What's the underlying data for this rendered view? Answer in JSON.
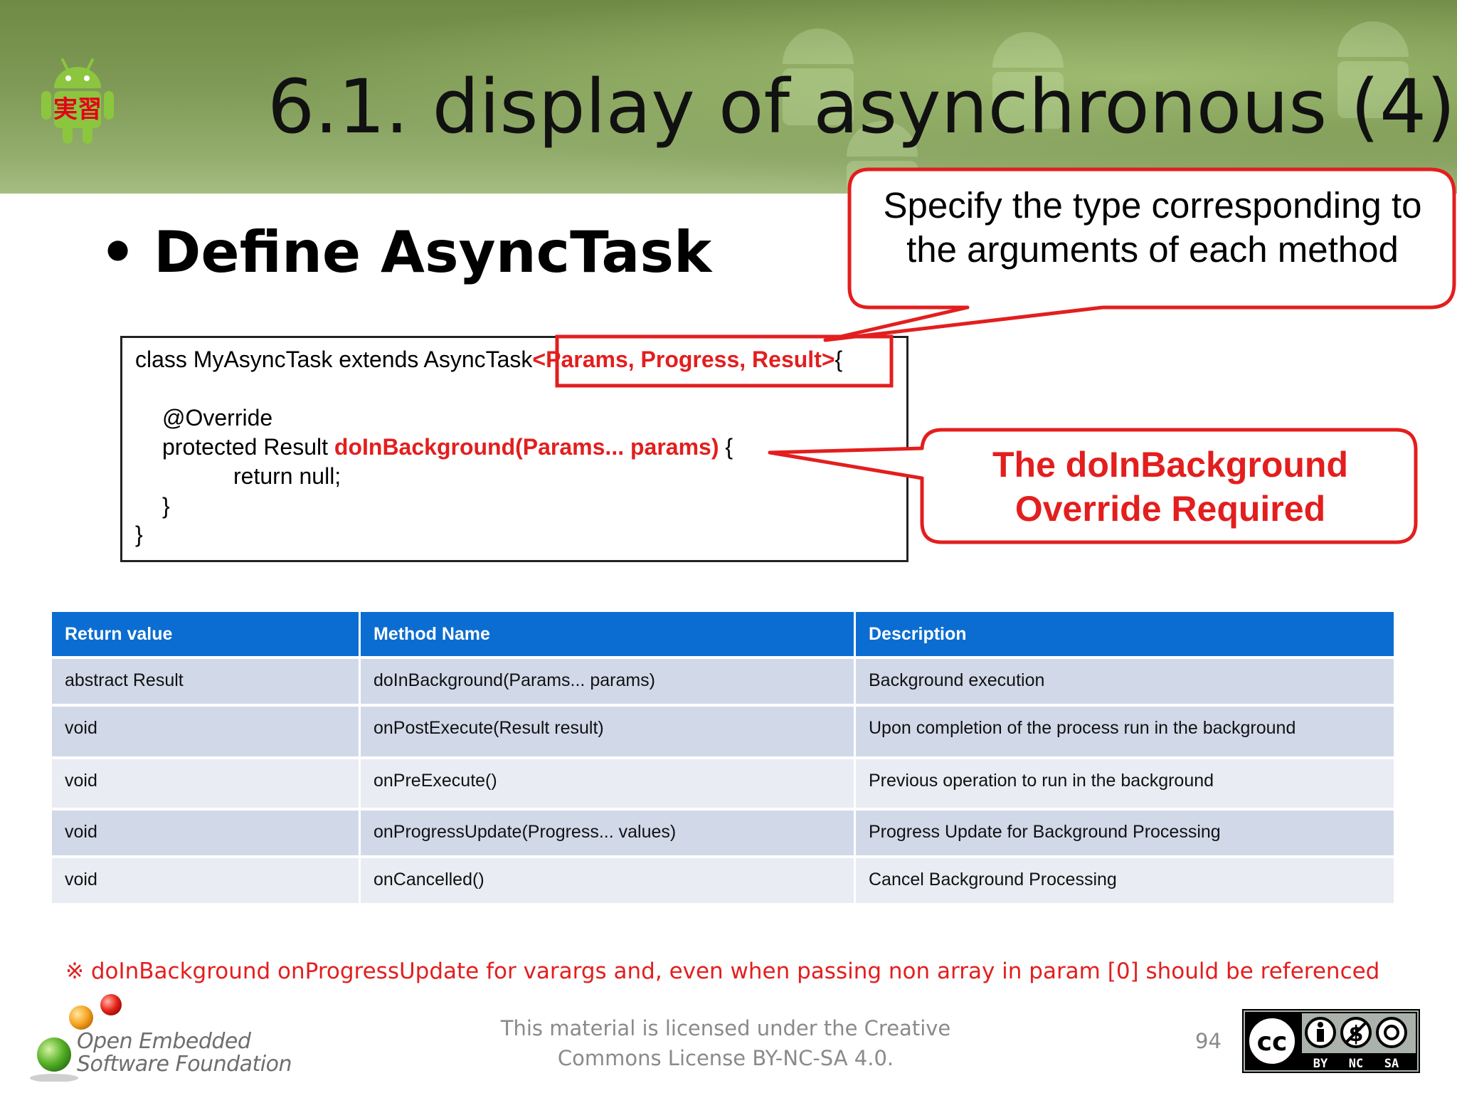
{
  "header": {
    "title": "6.1. display of asynchronous (4)",
    "logo_badge": "実習"
  },
  "bullet": {
    "text": "Define AsyncTask"
  },
  "callouts": {
    "types_note": [
      "Specify the type corresponding to",
      "the arguments of each method"
    ],
    "override_note": [
      "The doInBackground",
      "Override Required"
    ]
  },
  "code": {
    "line1_prefix": "class MyAsyncTask extends AsyncTask",
    "line1_generic": "<Params, Progress, Result>",
    "line1_suffix": "{",
    "line2": "@Override",
    "line3_prefix": "protected Result ",
    "line3_method": "doInBackground(Params... params)",
    "line3_suffix": " {",
    "line4": "return null;",
    "line5": "}",
    "line6": "}"
  },
  "table": {
    "headers": [
      "Return value",
      "Method Name",
      "Description"
    ],
    "rows": [
      [
        "abstract Result",
        "doInBackground(Params... params)",
        "Background execution"
      ],
      [
        "void",
        "onPostExecute(Result result)",
        "Upon completion of the process run in the background"
      ],
      [
        "void",
        "onPreExecute()",
        "Previous operation to run in the background"
      ],
      [
        "void",
        "onProgressUpdate(Progress... values)",
        "Progress Update for Background Processing"
      ],
      [
        "void",
        "onCancelled()",
        "Cancel Background Processing"
      ]
    ]
  },
  "note": "※ doInBackground onProgressUpdate for varargs and, even when passing non array in param [0] should be referenced",
  "footer": {
    "license_line1": "This material is licensed under the Creative",
    "license_line2": "Commons License BY-NC-SA 4.0.",
    "page_number": "94",
    "oesf_line1": "Open Embedded",
    "oesf_line2": "Software Foundation",
    "cc_labels": [
      "BY",
      "NC",
      "SA"
    ],
    "cc_mark": "cc"
  },
  "colors": {
    "accent_red": "#e31e1e",
    "table_header_blue": "#0b6dd1",
    "android_green": "#8cc63f"
  }
}
